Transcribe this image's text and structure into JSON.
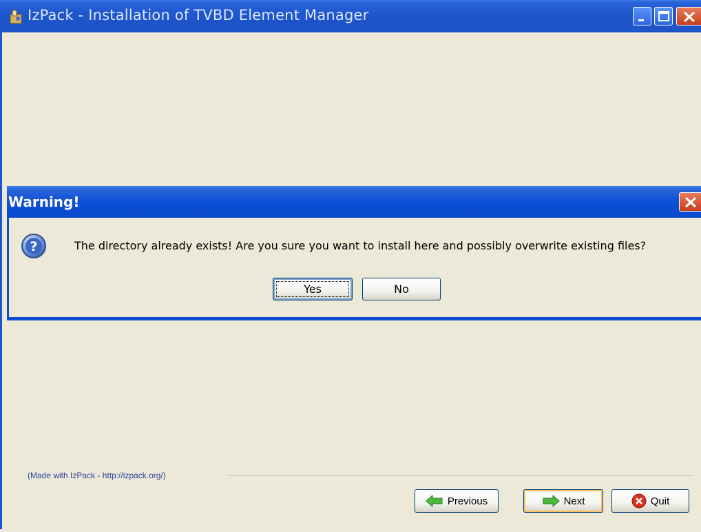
{
  "window": {
    "title": "IzPack - Installation of TVBD Element Manager",
    "accent": "#1f57cf"
  },
  "footer": {
    "made_with": "(Made with IzPack - http://izpack.org/)",
    "previous_label": "Previous",
    "next_label": "Next",
    "quit_label": "Quit"
  },
  "dialog": {
    "title": "Warning!",
    "message": "The directory already exists! Are you sure you want to install here and possibly overwrite existing files?",
    "yes_label": "Yes",
    "no_label": "No",
    "icon": "question-icon"
  },
  "icons": {
    "previous": "arrow-left-icon",
    "next": "arrow-right-icon",
    "quit": "stop-icon"
  }
}
